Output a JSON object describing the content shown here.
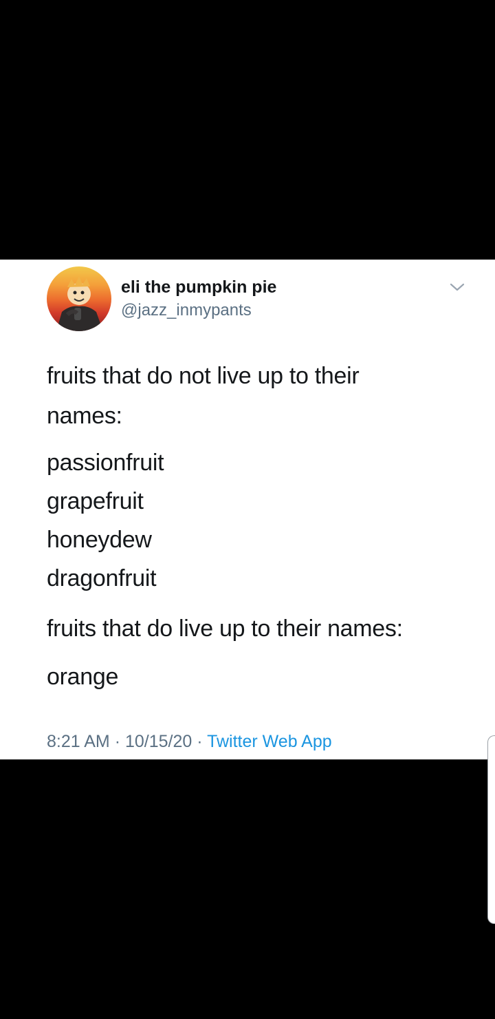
{
  "tweet": {
    "display_name": "eli the pumpkin pie",
    "handle": "@jazz_inmypants",
    "avatar_icon": "avatar-photo",
    "menu_icon": "chevron-down-icon",
    "lines": [
      "fruits that do not live up to their",
      "names:",
      "passionfruit",
      "grapefruit",
      "honeydew",
      "dragonfruit",
      "fruits that do live up to their names:",
      "orange"
    ],
    "time": "8:21 AM",
    "date": "10/15/20",
    "separator": "·",
    "source": "Twitter Web App"
  },
  "colors": {
    "background": "#000000",
    "card": "#ffffff",
    "text": "#14171a",
    "muted": "#5b7083",
    "link": "#1b95e0"
  }
}
